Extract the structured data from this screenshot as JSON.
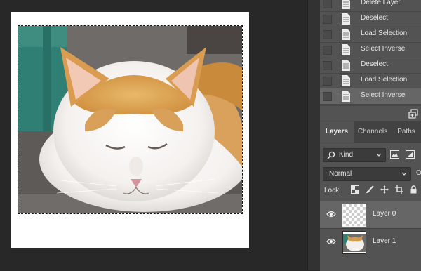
{
  "history": {
    "items": [
      {
        "label": "Delete Layer"
      },
      {
        "label": "Deselect"
      },
      {
        "label": "Load Selection"
      },
      {
        "label": "Select Inverse"
      },
      {
        "label": "Deselect"
      },
      {
        "label": "Load Selection"
      },
      {
        "label": "Select Inverse",
        "selected": true
      }
    ]
  },
  "layers_panel": {
    "tabs": [
      {
        "label": "Layers",
        "active": true
      },
      {
        "label": "Channels"
      },
      {
        "label": "Paths"
      }
    ],
    "filter": {
      "label": "Kind"
    },
    "blend_mode": "Normal",
    "opacity_cut": "O",
    "lock_label": "Lock:",
    "layers": [
      {
        "name": "Layer 0",
        "selected": true,
        "visible": true,
        "thumbnail": "transparent-checkerboard"
      },
      {
        "name": "Layer 1",
        "selected": false,
        "visible": true,
        "thumbnail": "cat-photo"
      }
    ]
  },
  "colors": {
    "workspace": "#282828",
    "panel": "#535353",
    "selected_row": "#666666"
  }
}
